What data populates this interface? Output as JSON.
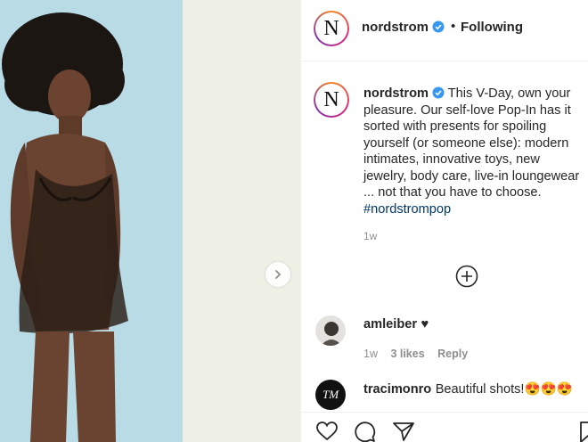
{
  "post": {
    "account": "nordstrom",
    "avatar_letter": "N",
    "dot": "•",
    "follow_label": "Following",
    "caption_lines": [
      "This V-Day, own your",
      "pleasure. Our self-love Pop-In has it",
      "sorted with presents for spoiling",
      "yourself (or someone else): modern",
      "intimates, innovative toys, new",
      "jewelry, body care, live-in loungewear",
      "... not that you have to choose."
    ],
    "hashtag": "#nordstrompop",
    "posted_ago": "1w"
  },
  "comments": [
    {
      "user": "amleiber",
      "text": "♥",
      "ago": "1w",
      "likes": "3 likes",
      "reply": "Reply"
    },
    {
      "user": "tracimonro",
      "text": "Beautiful shots!😍😍😍",
      "avatar_letters": "TM"
    }
  ],
  "icons": {
    "verified": "verified-badge-icon",
    "next": "chevron-right-icon",
    "more": "plus-circle-icon",
    "like": "heart-icon",
    "comment": "comment-bubble-icon",
    "share": "paper-plane-icon",
    "save": "bookmark-icon"
  },
  "colors": {
    "verified_blue": "#3897f0",
    "hashtag": "#00376b",
    "muted": "#8e8e8e",
    "text": "#262626"
  }
}
